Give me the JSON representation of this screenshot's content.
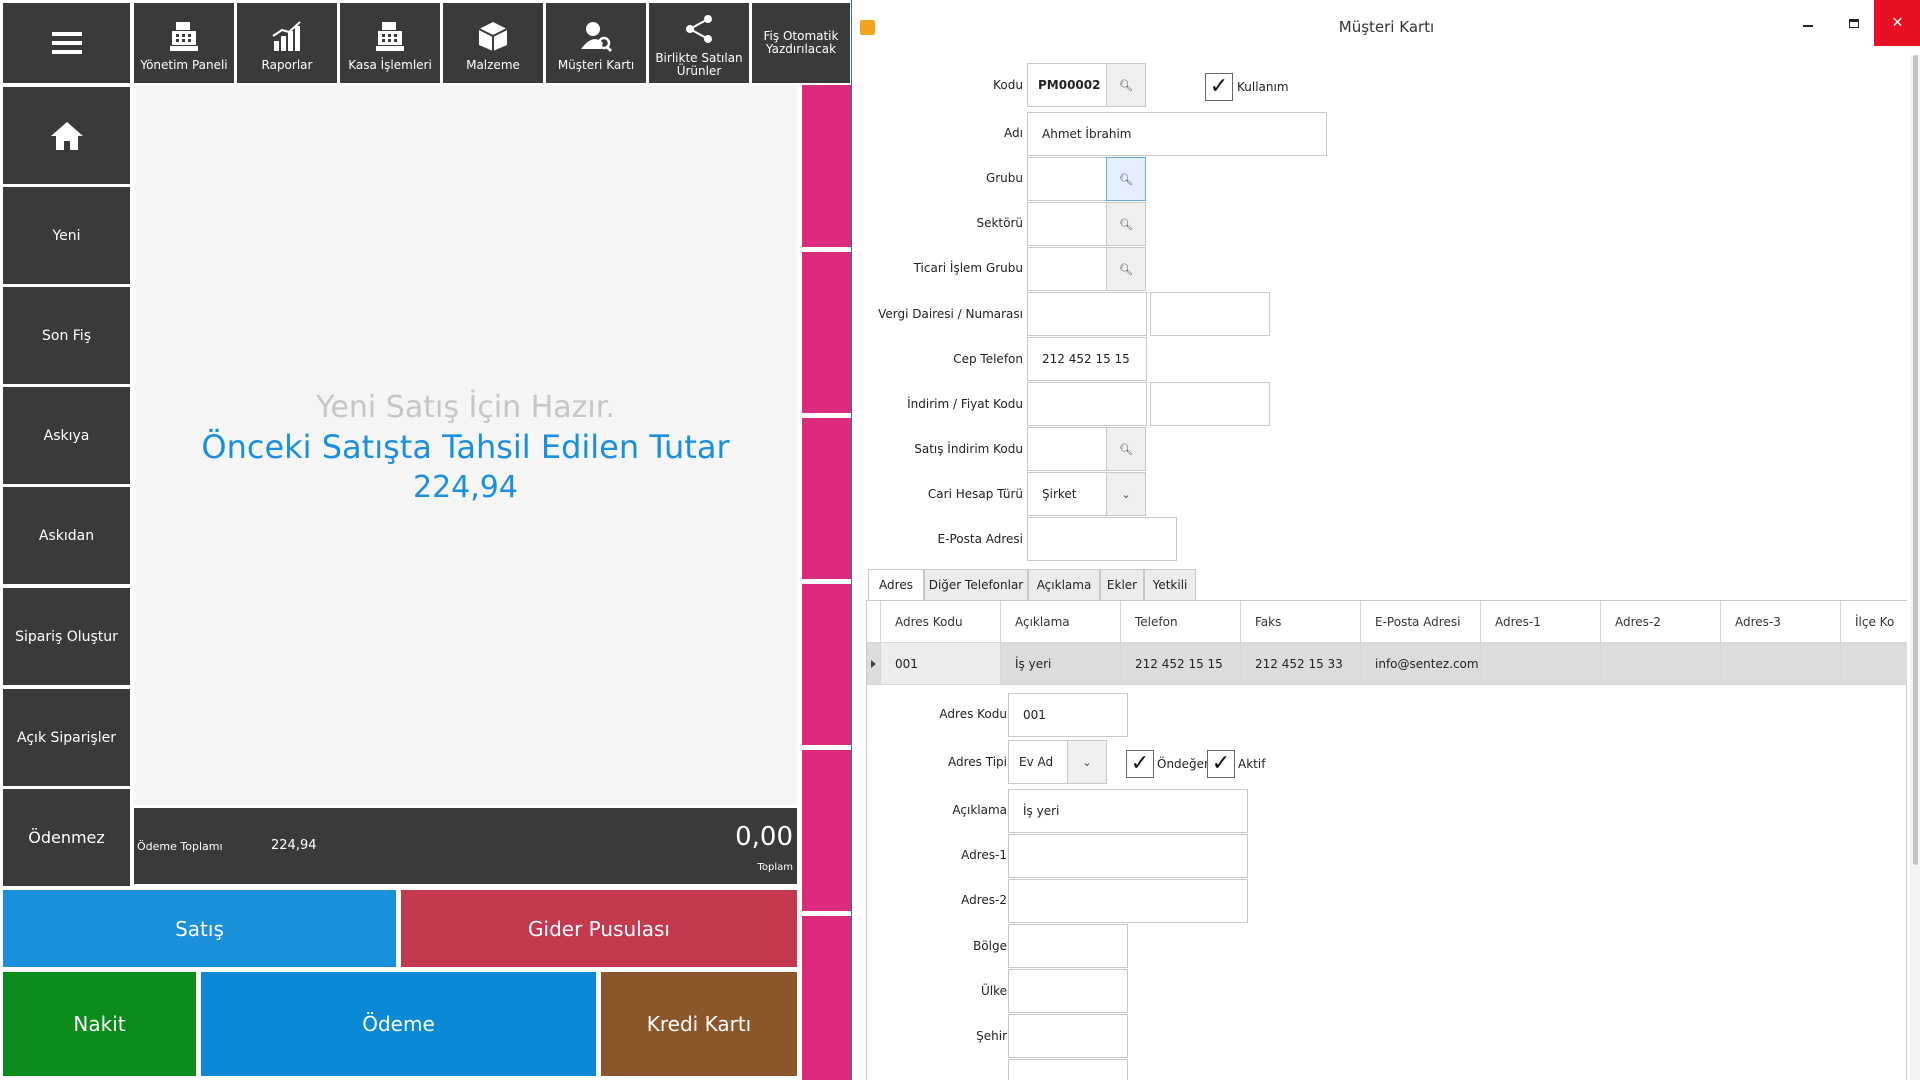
{
  "pos": {
    "toolbar": {
      "items": [
        {
          "label": "Yönetim Paneli",
          "icon": "cash-register-icon"
        },
        {
          "label": "Raporlar",
          "icon": "bar-chart-icon"
        },
        {
          "label": "Kasa İşlemleri",
          "icon": "cash-register-icon"
        },
        {
          "label": "Malzeme",
          "icon": "box-icon"
        },
        {
          "label": "Müşteri Kartı",
          "icon": "user-search-icon"
        },
        {
          "label": "Birlikte Satılan Ürünler",
          "icon": "share-icon"
        },
        {
          "label": "Fiş Otomatik Yazdırılacak"
        }
      ]
    },
    "sidebar": {
      "items": [
        "Yeni",
        "Son Fiş",
        "Askıya",
        "Askıdan",
        "Sipariş Oluştur",
        "Açık Siparişler",
        "Ödenmez"
      ]
    },
    "message": {
      "line1": "Yeni Satış İçin Hazır.",
      "line2": "Önceki Satışta Tahsil Edilen Tutar",
      "amount": "224,94"
    },
    "totals": {
      "payment_label": "Ödeme Toplamı",
      "payment_value": "224,94",
      "total_value": "0,00",
      "total_label": "Toplam"
    },
    "buttons": {
      "satis": "Satış",
      "gider": "Gider Pusulası",
      "nakit": "Nakit",
      "odeme": "Ödeme",
      "kredi": "Kredi Kartı"
    },
    "colors": {
      "tile": "#3a3a3a",
      "pink": "#dc2a7d",
      "blue": "#1a8fdc",
      "red": "#c4394f",
      "green": "#0a8c1a",
      "odeme": "#0a89d6",
      "brown": "#8a572a"
    }
  },
  "dialog": {
    "title": "Müşteri Kartı",
    "fields": {
      "kodu": {
        "label": "Kodu",
        "value": "PM00002"
      },
      "kullanim": {
        "label": "Kullanım",
        "checked": true
      },
      "adi": {
        "label": "Adı",
        "value": "Ahmet İbrahim"
      },
      "grubu": {
        "label": "Grubu",
        "value": ""
      },
      "sektoru": {
        "label": "Sektörü",
        "value": ""
      },
      "ticari": {
        "label": "Ticari İşlem Grubu",
        "value": ""
      },
      "vergi": {
        "label": "Vergi Dairesi / Numarası",
        "value": ""
      },
      "cep": {
        "label": "Cep Telefon",
        "value": "212 452 15 15"
      },
      "indirim": {
        "label": "İndirim / Fiyat Kodu",
        "value": ""
      },
      "satis_indirim": {
        "label": "Satış İndirim Kodu",
        "value": ""
      },
      "cari": {
        "label": "Cari Hesap Türü",
        "value": "Şirket"
      },
      "eposta": {
        "label": "E-Posta Adresi",
        "value": ""
      }
    },
    "tabs": [
      "Adres",
      "Diğer Telefonlar",
      "Açıklama",
      "Ekler",
      "Yetkili"
    ],
    "grid": {
      "columns": [
        "Adres Kodu",
        "Açıklama",
        "Telefon",
        "Faks",
        "E-Posta Adresi",
        "Adres-1",
        "Adres-2",
        "Adres-3",
        "İlçe Ko"
      ],
      "row": [
        "001",
        "İş yeri",
        "212 452 15 15",
        "212 452 15 33",
        "info@sentez.com",
        "",
        "",
        "",
        ""
      ]
    },
    "address": {
      "kodu": {
        "label": "Adres Kodu",
        "value": "001"
      },
      "tipi": {
        "label": "Adres Tipi",
        "value": "Ev Ad"
      },
      "ondeger": {
        "label": "Öndeğer",
        "checked": true
      },
      "aktif": {
        "label": "Aktif",
        "checked": true
      },
      "aciklama": {
        "label": "Açıklama",
        "value": "İş yeri"
      },
      "adres1": {
        "label": "Adres-1",
        "value": ""
      },
      "adres2": {
        "label": "Adres-2",
        "value": ""
      },
      "bolge": {
        "label": "Bölge",
        "value": ""
      },
      "ulke": {
        "label": "Ülke",
        "value": ""
      },
      "sehir": {
        "label": "Şehir",
        "value": ""
      }
    }
  }
}
